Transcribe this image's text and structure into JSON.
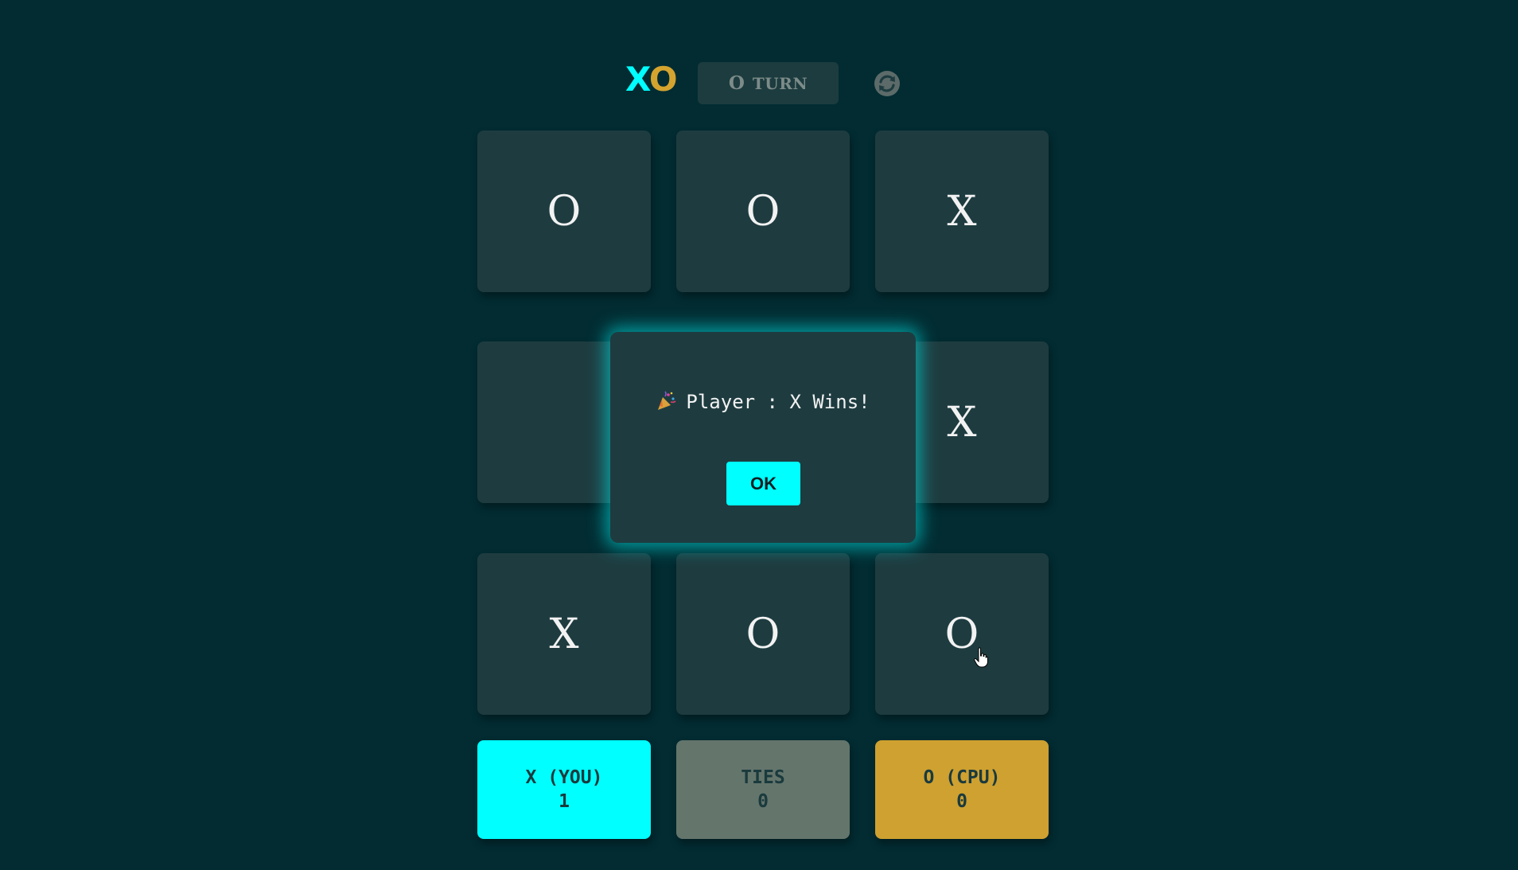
{
  "header": {
    "logo_x": "X",
    "logo_o": "O",
    "turn_mark": "O",
    "turn_label": "TURN",
    "restart_icon": "restart-icon"
  },
  "board": {
    "cells": [
      "O",
      "O",
      "X",
      "",
      "",
      "X",
      "X",
      "O",
      "O"
    ]
  },
  "scores": {
    "x": {
      "label": "X (YOU)",
      "value": "1"
    },
    "ties": {
      "label": "TIES",
      "value": "0"
    },
    "o": {
      "label": "O (CPU)",
      "value": "0"
    }
  },
  "modal": {
    "icon": "party-popper-icon",
    "message": "Player : X Wins!",
    "ok_label": "OK"
  },
  "colors": {
    "background": "#022c32",
    "cell": "#1e3c40",
    "x_accent": "#00ffff",
    "o_accent": "#cfa130",
    "ties": "#64756c"
  }
}
